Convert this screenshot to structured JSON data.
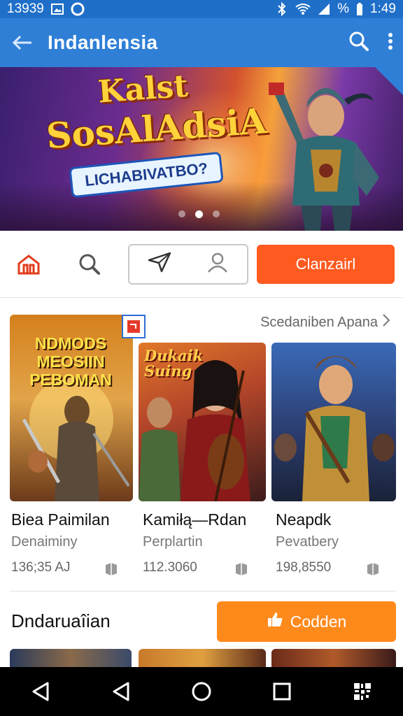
{
  "status_bar": {
    "left_text": "13939",
    "battery_text": "%",
    "time": "1:49"
  },
  "app_bar": {
    "title": "Indanlensia",
    "icons": [
      "back-arrow-icon",
      "search-icon",
      "more-vert-icon"
    ]
  },
  "banner": {
    "line1": "Kalst",
    "line2": "SosAlAdsiA",
    "ribbon": "LICHABIVATBO?",
    "carousel_dots": 3,
    "active_dot": 2
  },
  "toolbar": {
    "icons": [
      "home-icon",
      "search-icon",
      "send-icon",
      "profile-icon"
    ],
    "button_label": "Clanzairl"
  },
  "section1": {
    "link_label": "Scedaniben Apana"
  },
  "cards": [
    {
      "image_text": "NDMODS MEOSIIN PEBOMAN",
      "name": "Biea Paimilan",
      "sub": "Denaiminy",
      "count": "136;35 AJ"
    },
    {
      "image_text": "Dukaik Suing",
      "name": "Kamiłą—Rdan",
      "sub": "Perplartin",
      "count": "112.3060"
    },
    {
      "image_text": "",
      "name": "Neapdk",
      "sub": "Pevatbery",
      "count": "198,8550"
    }
  ],
  "section2": {
    "title": "Dndaruaîian",
    "button_label": "Codden"
  },
  "colors": {
    "app_bar": "#2f7fd6",
    "status_bar": "#1f6fc9",
    "primary_button": "#ff5a1f",
    "cta_button": "#ff8a1c"
  }
}
